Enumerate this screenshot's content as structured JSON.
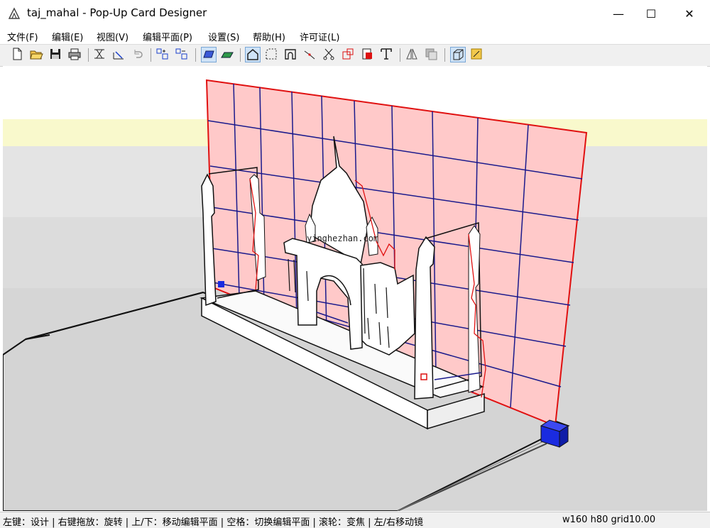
{
  "window": {
    "title": "taj_mahal - Pop-Up Card Designer",
    "minimize": "—",
    "maximize": "☐",
    "close": "✕"
  },
  "menu": {
    "file": "文件(F)",
    "edit": "编辑(E)",
    "view": "视图(V)",
    "edit_plane": "编辑平面(P)",
    "settings": "设置(S)",
    "help": "帮助(H)",
    "license": "许可证(L)"
  },
  "toolbar": {
    "buttons": [
      "new-file-icon",
      "open-folder-icon",
      "save-icon",
      "print-icon",
      "fit-view-icon",
      "transform-icon",
      "undo-icon",
      "grid-add-icon",
      "grid-remove-icon",
      "plane-blue-icon",
      "plane-green-icon",
      "polygon-icon",
      "dashed-rect-icon",
      "arch-icon",
      "line-icon",
      "cut-icon",
      "square-icon",
      "fill-icon",
      "text-icon",
      "mirror-icon",
      "copy-icon",
      "view3d-icon",
      "paint-icon"
    ],
    "active": [
      "plane-blue-icon",
      "polygon-icon",
      "view3d-icon"
    ]
  },
  "viewport": {
    "watermark": "yinghezhan.com",
    "colors": {
      "back_plane": "#ffc9c9",
      "back_plane_border": "#e01010",
      "grid": "#1a1a8c",
      "highlight_band": "#f9f9cc",
      "handle": "#1a2be0"
    }
  },
  "status": {
    "hints": "左键：设计 | 右键拖放：旋转 | 上/下：移动编辑平面 | 空格：切换编辑平面 | 滚轮：变焦 | 左/右移动镜",
    "dimensions": "w160 h80 grid10.00"
  }
}
